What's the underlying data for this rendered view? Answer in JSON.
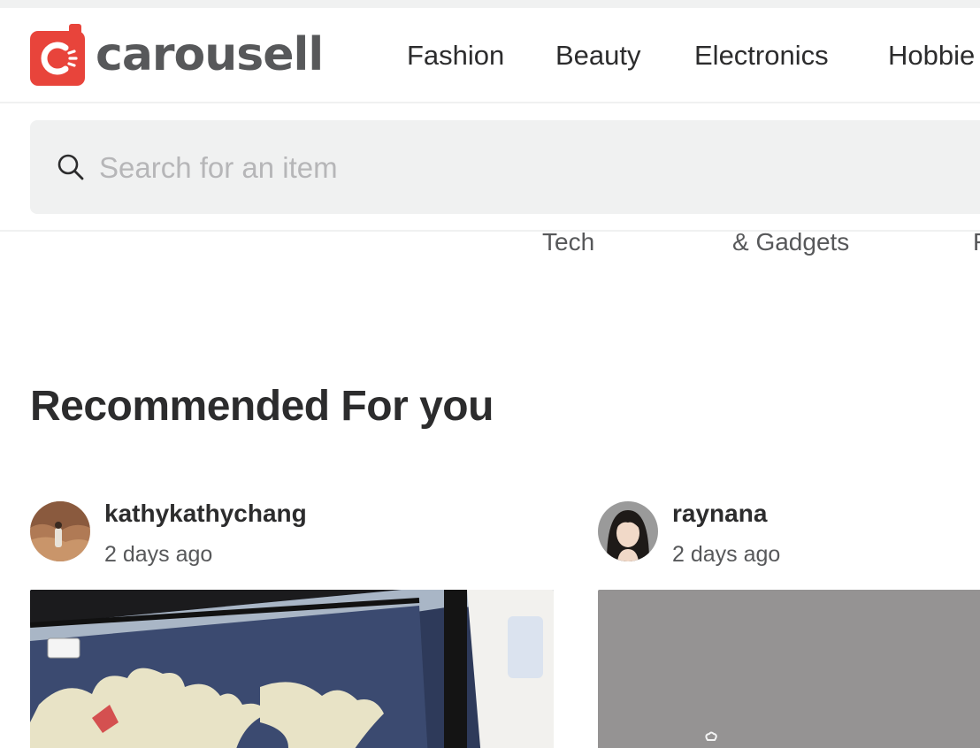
{
  "header": {
    "logo_text": "carousell",
    "brand_color": "#e8443b",
    "nav": [
      {
        "label": "Fashion"
      },
      {
        "label": "Beauty"
      },
      {
        "label": "Electronics"
      },
      {
        "label": "Hobbie"
      }
    ]
  },
  "search": {
    "placeholder": "Search for an item",
    "value": "",
    "icon": "search-icon"
  },
  "category_fragments": [
    "Tech",
    "& Gadgets",
    "F"
  ],
  "section": {
    "title": "Recommended For you"
  },
  "listings": [
    {
      "seller": "kathykathychang",
      "time": "2 days ago"
    },
    {
      "seller": "raynana",
      "time": "2 days ago"
    }
  ],
  "colors": {
    "text_primary": "#2c2c2d",
    "text_secondary": "#57585a",
    "placeholder": "#b6b6b8",
    "surface": "#f0f1f1"
  }
}
